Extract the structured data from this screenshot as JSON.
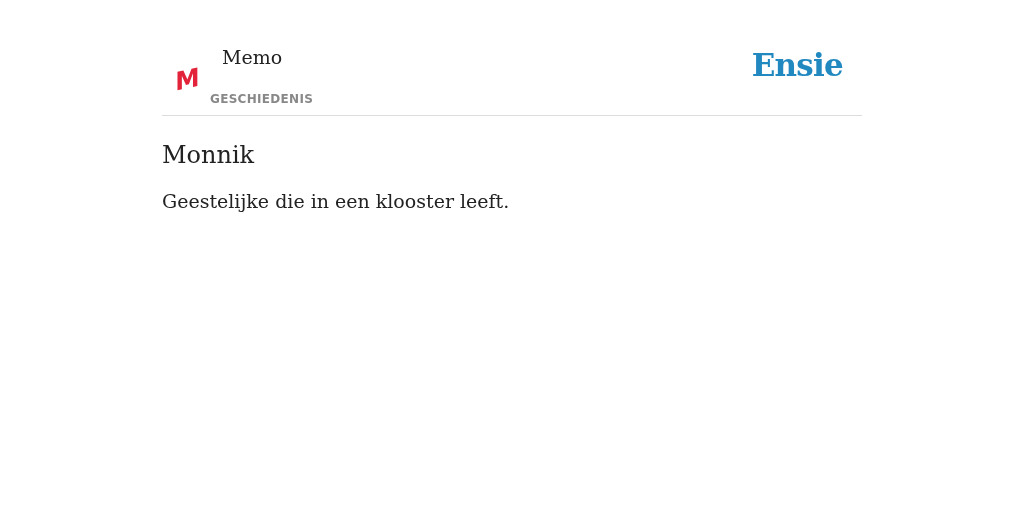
{
  "header": {
    "logo": "M",
    "title": "Memo",
    "category": "GESCHIEDENIS",
    "brand": "Ensie"
  },
  "entry": {
    "term": "Monnik",
    "definition": "Geestelijke die in een klooster leeft."
  }
}
